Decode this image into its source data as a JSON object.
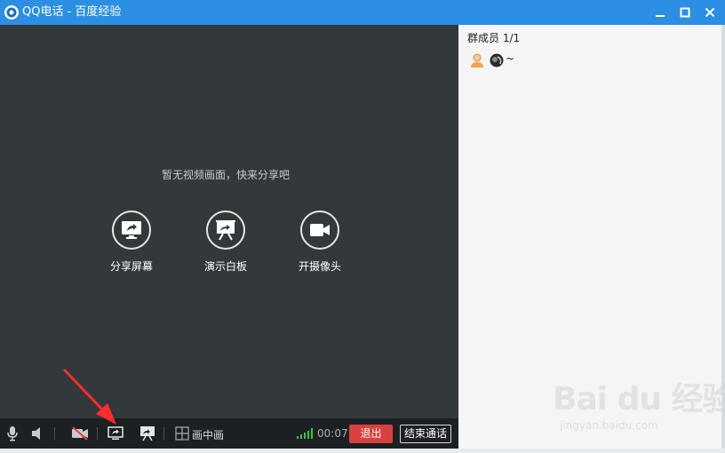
{
  "window": {
    "title": "QQ电话 - 百度经验",
    "controls": [
      "minimize-icon",
      "maximize-icon",
      "close-icon"
    ]
  },
  "video": {
    "empty_hint": "暂无视频画面，快来分享吧",
    "actions": [
      {
        "label": "分享屏幕",
        "icon": "share-screen-icon"
      },
      {
        "label": "演示白板",
        "icon": "whiteboard-icon"
      },
      {
        "label": "开摄像头",
        "icon": "camera-icon"
      }
    ]
  },
  "toolbar": {
    "icons": [
      "microphone-icon",
      "speaker-icon",
      "camera-off-icon",
      "share-screen-icon",
      "whiteboard-icon",
      "picture-in-picture-icon"
    ],
    "pip_label": "画中画",
    "signal_icon": "signal-strength-icon",
    "timer": "00:07",
    "exit_label": "退出",
    "end_call_label": "结束通话"
  },
  "members": {
    "header": "群成员 1/1",
    "list": [
      {
        "name": "~",
        "status_icon": "user-status-icon",
        "avatar_icon": "avatar-icon"
      }
    ]
  },
  "watermark": {
    "brand": "Bai du 经验",
    "url": "jingyan.baidu.com"
  },
  "colors": {
    "titlebar": "#2c8fe3",
    "video_bg": "#33383b",
    "toolbar_bg": "#1d2023",
    "exit_button": "#d8413d",
    "signal": "#3ec23e",
    "annotation_arrow": "#ff2a2a"
  }
}
